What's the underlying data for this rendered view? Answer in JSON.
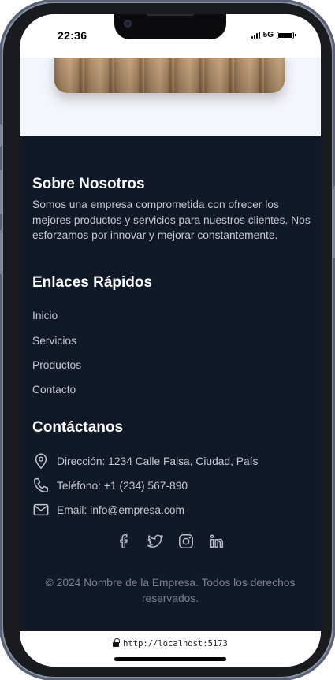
{
  "status_bar": {
    "time": "22:36",
    "network": "5G"
  },
  "about": {
    "title": "Sobre Nosotros",
    "text": "Somos una empresa comprometida con ofrecer los mejores productos y servicios para nuestros clientes. Nos esforzamos por innovar y mejorar constantemente."
  },
  "quick_links": {
    "title": "Enlaces Rápidos",
    "items": [
      "Inicio",
      "Servicios",
      "Productos",
      "Contacto"
    ]
  },
  "contact": {
    "title": "Contáctanos",
    "address": "Dirección: 1234 Calle Falsa, Ciudad, País",
    "phone": "Teléfono: +1 (234) 567-890",
    "email": "Email: info@empresa.com"
  },
  "socials": [
    "facebook-icon",
    "twitter-icon",
    "instagram-icon",
    "linkedin-icon"
  ],
  "copyright": "© 2024 Nombre de la Empresa. Todos los derechos reservados.",
  "browser": {
    "url": "http://localhost:5173"
  },
  "colors": {
    "footer_bg": "#111827",
    "page_bg": "#f3f6fd",
    "heading": "#ffffff",
    "text": "#c4c8d0",
    "muted": "#7b8190"
  }
}
